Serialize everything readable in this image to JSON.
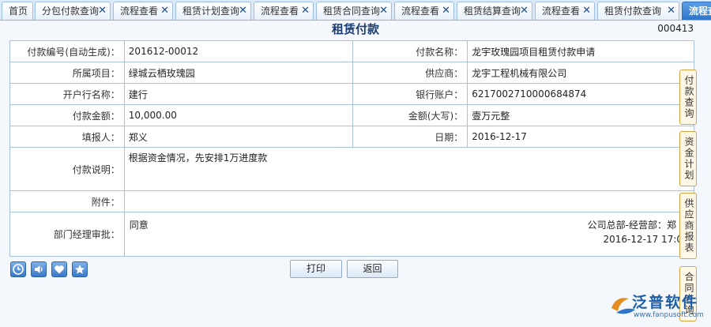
{
  "tabs": [
    {
      "label": "首页",
      "closable": false
    },
    {
      "label": "分包付款查询",
      "closable": true
    },
    {
      "label": "流程查看",
      "closable": true
    },
    {
      "label": "租赁计划查询",
      "closable": true
    },
    {
      "label": "流程查看",
      "closable": true
    },
    {
      "label": "租赁合同查询",
      "closable": true
    },
    {
      "label": "流程查看",
      "closable": true
    },
    {
      "label": "租赁结算查询",
      "closable": true
    },
    {
      "label": "流程查看",
      "closable": true
    },
    {
      "label": "租赁付款查询",
      "closable": true
    },
    {
      "label": "流程查看",
      "closable": false,
      "active": true
    }
  ],
  "page": {
    "title": "租赁付款",
    "doc_no": "000413"
  },
  "form": {
    "payment_no_label": "付款编号(自动生成)：",
    "payment_no": "201612-00012",
    "payment_name_label": "付款名称：",
    "payment_name": "龙宇玫瑰园项目租赁付款申请",
    "project_label": "所属项目：",
    "project": "绿城云栖玫瑰园",
    "supplier_label": "供应商：",
    "supplier": "龙宇工程机械有限公司",
    "bank_label": "开户行名称：",
    "bank": "建行",
    "account_label": "银行账户：",
    "account": "6217002710000684874",
    "amount_label": "付款金额：",
    "amount": "10,000.00",
    "amount_cn_label": "金额(大写)：",
    "amount_cn": "壹万元整",
    "filler_label": "填报人：",
    "filler": "郑义",
    "date_label": "日期：",
    "date": "2016-12-17",
    "remark_label": "付款说明：",
    "remark": "根据资金情况，先安排1万进度款",
    "attachment_label": "附件：",
    "approval_label": "部门经理审批：",
    "approval_opinion": "同意",
    "approval_dept": "公司总部-经营部：郑",
    "approval_time": "2016-12-17 17:0"
  },
  "side_tabs": [
    {
      "label": "付款查询"
    },
    {
      "label": "资金计划"
    },
    {
      "label": "供应商报表"
    },
    {
      "label": "合同查询"
    }
  ],
  "toolbar": {
    "icons": [
      "clock-icon",
      "speaker-icon",
      "heart-icon",
      "star-icon"
    ],
    "print_label": "打印",
    "back_label": "返回"
  },
  "logo": {
    "text": "泛普软件",
    "url_text": "www.fanpusoft.com"
  },
  "colors": {
    "tab_active": "#2f74c8",
    "border": "#a8c2df",
    "link": "#1e3fb0",
    "side_tab_border": "#d9a544"
  }
}
